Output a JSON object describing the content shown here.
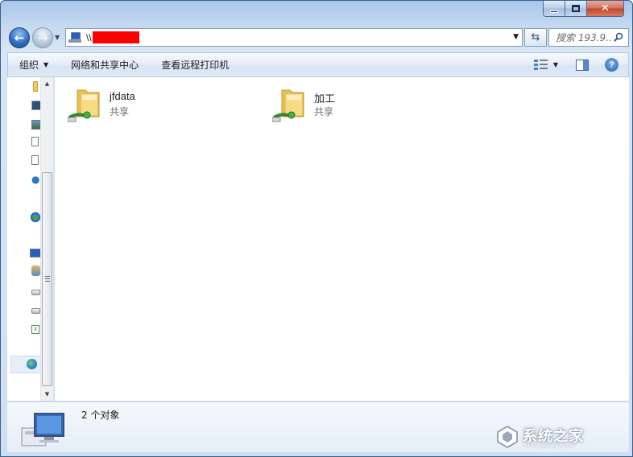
{
  "address": {
    "path_prefix": "\\\\"
  },
  "search": {
    "placeholder": "搜索 193.9..."
  },
  "toolbar": {
    "organize_label": "组织",
    "network_sharing_label": "网络和共享中心",
    "remote_printers_label": "查看远程打印机"
  },
  "shares": [
    {
      "name": "jfdata",
      "type": "共享"
    },
    {
      "name": "加工",
      "type": "共享"
    }
  ],
  "status": {
    "item_count": "2 个对象"
  },
  "watermark": {
    "text": "系统之家",
    "sub": "XITONGZHIJIA.NET"
  },
  "colors": {
    "redaction": "#ff0000",
    "accent": "#2a6bc0"
  }
}
